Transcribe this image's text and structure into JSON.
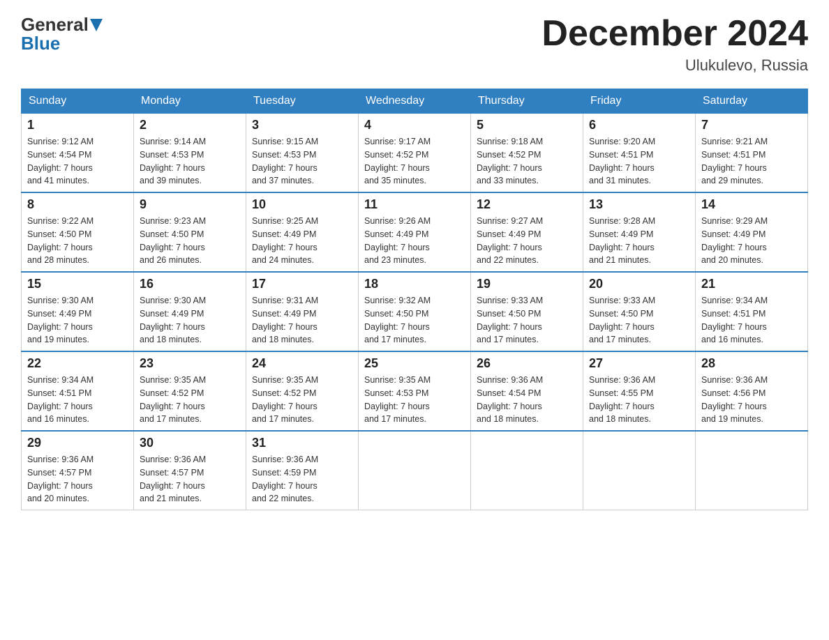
{
  "header": {
    "logo_general": "General",
    "logo_blue": "Blue",
    "month_title": "December 2024",
    "location": "Ulukulevo, Russia"
  },
  "days_of_week": [
    "Sunday",
    "Monday",
    "Tuesday",
    "Wednesday",
    "Thursday",
    "Friday",
    "Saturday"
  ],
  "weeks": [
    [
      {
        "day": "1",
        "sunrise": "Sunrise: 9:12 AM",
        "sunset": "Sunset: 4:54 PM",
        "daylight": "Daylight: 7 hours",
        "minutes": "and 41 minutes."
      },
      {
        "day": "2",
        "sunrise": "Sunrise: 9:14 AM",
        "sunset": "Sunset: 4:53 PM",
        "daylight": "Daylight: 7 hours",
        "minutes": "and 39 minutes."
      },
      {
        "day": "3",
        "sunrise": "Sunrise: 9:15 AM",
        "sunset": "Sunset: 4:53 PM",
        "daylight": "Daylight: 7 hours",
        "minutes": "and 37 minutes."
      },
      {
        "day": "4",
        "sunrise": "Sunrise: 9:17 AM",
        "sunset": "Sunset: 4:52 PM",
        "daylight": "Daylight: 7 hours",
        "minutes": "and 35 minutes."
      },
      {
        "day": "5",
        "sunrise": "Sunrise: 9:18 AM",
        "sunset": "Sunset: 4:52 PM",
        "daylight": "Daylight: 7 hours",
        "minutes": "and 33 minutes."
      },
      {
        "day": "6",
        "sunrise": "Sunrise: 9:20 AM",
        "sunset": "Sunset: 4:51 PM",
        "daylight": "Daylight: 7 hours",
        "minutes": "and 31 minutes."
      },
      {
        "day": "7",
        "sunrise": "Sunrise: 9:21 AM",
        "sunset": "Sunset: 4:51 PM",
        "daylight": "Daylight: 7 hours",
        "minutes": "and 29 minutes."
      }
    ],
    [
      {
        "day": "8",
        "sunrise": "Sunrise: 9:22 AM",
        "sunset": "Sunset: 4:50 PM",
        "daylight": "Daylight: 7 hours",
        "minutes": "and 28 minutes."
      },
      {
        "day": "9",
        "sunrise": "Sunrise: 9:23 AM",
        "sunset": "Sunset: 4:50 PM",
        "daylight": "Daylight: 7 hours",
        "minutes": "and 26 minutes."
      },
      {
        "day": "10",
        "sunrise": "Sunrise: 9:25 AM",
        "sunset": "Sunset: 4:49 PM",
        "daylight": "Daylight: 7 hours",
        "minutes": "and 24 minutes."
      },
      {
        "day": "11",
        "sunrise": "Sunrise: 9:26 AM",
        "sunset": "Sunset: 4:49 PM",
        "daylight": "Daylight: 7 hours",
        "minutes": "and 23 minutes."
      },
      {
        "day": "12",
        "sunrise": "Sunrise: 9:27 AM",
        "sunset": "Sunset: 4:49 PM",
        "daylight": "Daylight: 7 hours",
        "minutes": "and 22 minutes."
      },
      {
        "day": "13",
        "sunrise": "Sunrise: 9:28 AM",
        "sunset": "Sunset: 4:49 PM",
        "daylight": "Daylight: 7 hours",
        "minutes": "and 21 minutes."
      },
      {
        "day": "14",
        "sunrise": "Sunrise: 9:29 AM",
        "sunset": "Sunset: 4:49 PM",
        "daylight": "Daylight: 7 hours",
        "minutes": "and 20 minutes."
      }
    ],
    [
      {
        "day": "15",
        "sunrise": "Sunrise: 9:30 AM",
        "sunset": "Sunset: 4:49 PM",
        "daylight": "Daylight: 7 hours",
        "minutes": "and 19 minutes."
      },
      {
        "day": "16",
        "sunrise": "Sunrise: 9:30 AM",
        "sunset": "Sunset: 4:49 PM",
        "daylight": "Daylight: 7 hours",
        "minutes": "and 18 minutes."
      },
      {
        "day": "17",
        "sunrise": "Sunrise: 9:31 AM",
        "sunset": "Sunset: 4:49 PM",
        "daylight": "Daylight: 7 hours",
        "minutes": "and 18 minutes."
      },
      {
        "day": "18",
        "sunrise": "Sunrise: 9:32 AM",
        "sunset": "Sunset: 4:50 PM",
        "daylight": "Daylight: 7 hours",
        "minutes": "and 17 minutes."
      },
      {
        "day": "19",
        "sunrise": "Sunrise: 9:33 AM",
        "sunset": "Sunset: 4:50 PM",
        "daylight": "Daylight: 7 hours",
        "minutes": "and 17 minutes."
      },
      {
        "day": "20",
        "sunrise": "Sunrise: 9:33 AM",
        "sunset": "Sunset: 4:50 PM",
        "daylight": "Daylight: 7 hours",
        "minutes": "and 17 minutes."
      },
      {
        "day": "21",
        "sunrise": "Sunrise: 9:34 AM",
        "sunset": "Sunset: 4:51 PM",
        "daylight": "Daylight: 7 hours",
        "minutes": "and 16 minutes."
      }
    ],
    [
      {
        "day": "22",
        "sunrise": "Sunrise: 9:34 AM",
        "sunset": "Sunset: 4:51 PM",
        "daylight": "Daylight: 7 hours",
        "minutes": "and 16 minutes."
      },
      {
        "day": "23",
        "sunrise": "Sunrise: 9:35 AM",
        "sunset": "Sunset: 4:52 PM",
        "daylight": "Daylight: 7 hours",
        "minutes": "and 17 minutes."
      },
      {
        "day": "24",
        "sunrise": "Sunrise: 9:35 AM",
        "sunset": "Sunset: 4:52 PM",
        "daylight": "Daylight: 7 hours",
        "minutes": "and 17 minutes."
      },
      {
        "day": "25",
        "sunrise": "Sunrise: 9:35 AM",
        "sunset": "Sunset: 4:53 PM",
        "daylight": "Daylight: 7 hours",
        "minutes": "and 17 minutes."
      },
      {
        "day": "26",
        "sunrise": "Sunrise: 9:36 AM",
        "sunset": "Sunset: 4:54 PM",
        "daylight": "Daylight: 7 hours",
        "minutes": "and 18 minutes."
      },
      {
        "day": "27",
        "sunrise": "Sunrise: 9:36 AM",
        "sunset": "Sunset: 4:55 PM",
        "daylight": "Daylight: 7 hours",
        "minutes": "and 18 minutes."
      },
      {
        "day": "28",
        "sunrise": "Sunrise: 9:36 AM",
        "sunset": "Sunset: 4:56 PM",
        "daylight": "Daylight: 7 hours",
        "minutes": "and 19 minutes."
      }
    ],
    [
      {
        "day": "29",
        "sunrise": "Sunrise: 9:36 AM",
        "sunset": "Sunset: 4:57 PM",
        "daylight": "Daylight: 7 hours",
        "minutes": "and 20 minutes."
      },
      {
        "day": "30",
        "sunrise": "Sunrise: 9:36 AM",
        "sunset": "Sunset: 4:57 PM",
        "daylight": "Daylight: 7 hours",
        "minutes": "and 21 minutes."
      },
      {
        "day": "31",
        "sunrise": "Sunrise: 9:36 AM",
        "sunset": "Sunset: 4:59 PM",
        "daylight": "Daylight: 7 hours",
        "minutes": "and 22 minutes."
      },
      {
        "day": "",
        "sunrise": "",
        "sunset": "",
        "daylight": "",
        "minutes": ""
      },
      {
        "day": "",
        "sunrise": "",
        "sunset": "",
        "daylight": "",
        "minutes": ""
      },
      {
        "day": "",
        "sunrise": "",
        "sunset": "",
        "daylight": "",
        "minutes": ""
      },
      {
        "day": "",
        "sunrise": "",
        "sunset": "",
        "daylight": "",
        "minutes": ""
      }
    ]
  ]
}
